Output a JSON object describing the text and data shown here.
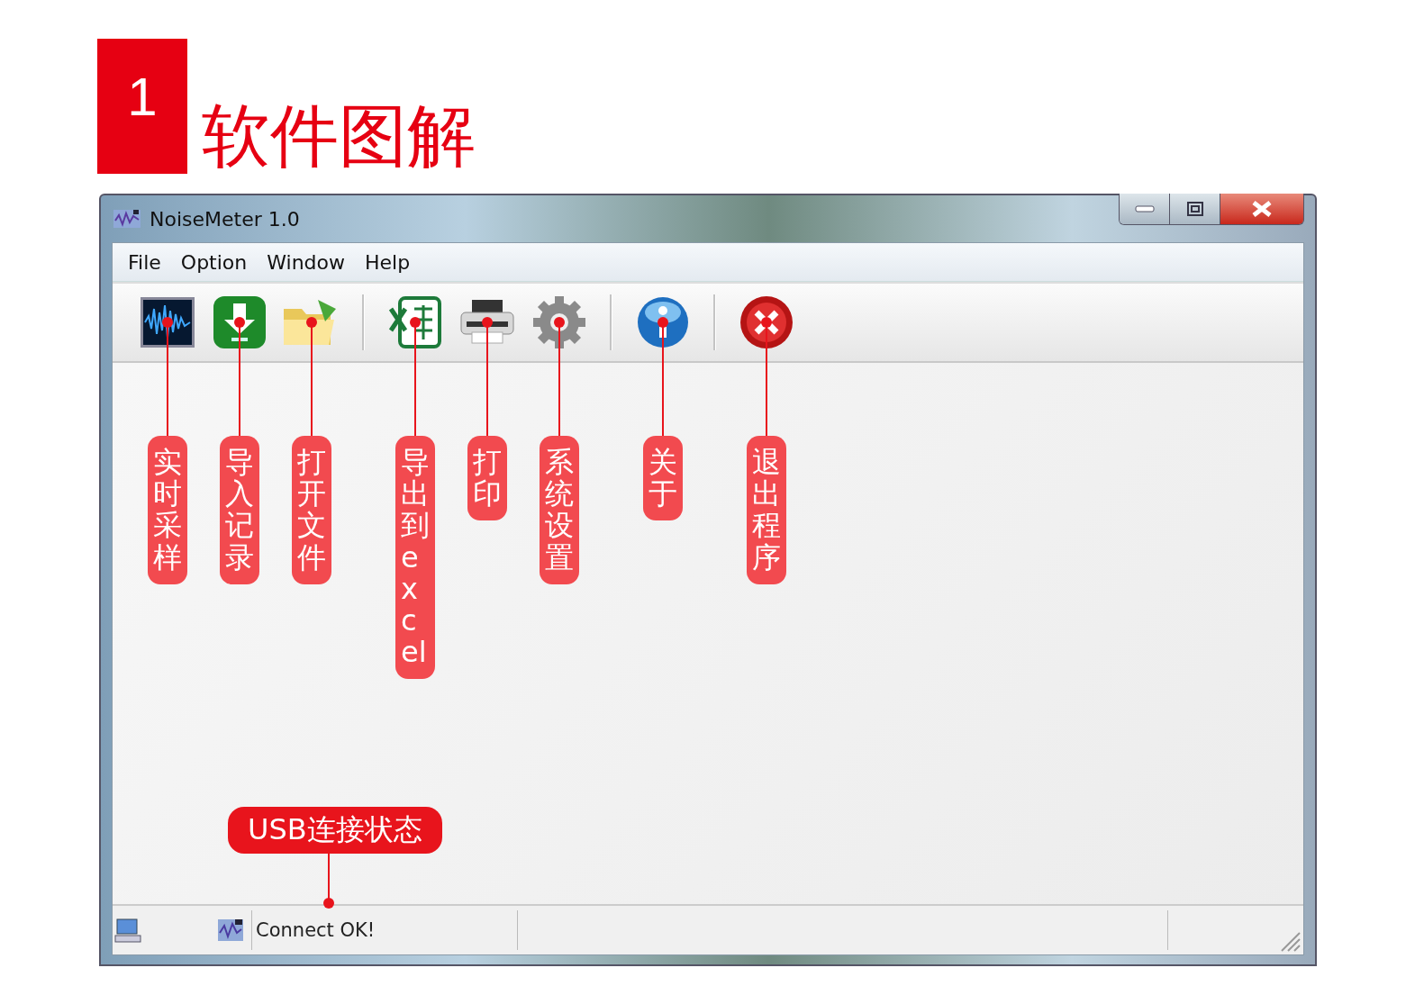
{
  "heading": {
    "number": "1",
    "title": "软件图解"
  },
  "window": {
    "title": "NoiseMeter 1.0"
  },
  "menu": [
    "File",
    "Option",
    "Window",
    "Help"
  ],
  "toolbar": {
    "groups": [
      [
        {
          "annotation": "实时采样"
        },
        {
          "annotation": "导入记录"
        },
        {
          "annotation": "打开文件"
        }
      ],
      [
        {
          "annotation": "导出到excel"
        },
        {
          "annotation": "打印"
        },
        {
          "annotation": "系统设置"
        }
      ],
      [
        {
          "annotation": "关于"
        }
      ],
      [
        {
          "annotation": "退出程序"
        }
      ]
    ]
  },
  "usb_annotation": "USB连接状态",
  "status_bar": {
    "message": "Connect OK!"
  }
}
